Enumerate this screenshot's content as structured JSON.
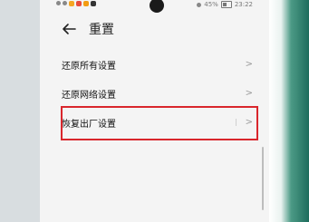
{
  "status": {
    "battery": "45%",
    "time": "23:22"
  },
  "header": {
    "back_icon": "arrow-left-icon",
    "title": "重置"
  },
  "items": [
    {
      "label": "还原所有设置",
      "chevron": "chevron-right-icon"
    },
    {
      "label": "还原网络设置",
      "chevron": "chevron-right-icon"
    },
    {
      "label": "恢复出厂设置",
      "chevron": "chevron-right-icon",
      "highlighted": true
    }
  ],
  "colors": {
    "highlight": "#d9262c",
    "text": "#111111",
    "chevron": "#9a9a9a",
    "background": "#f4f4f4"
  }
}
